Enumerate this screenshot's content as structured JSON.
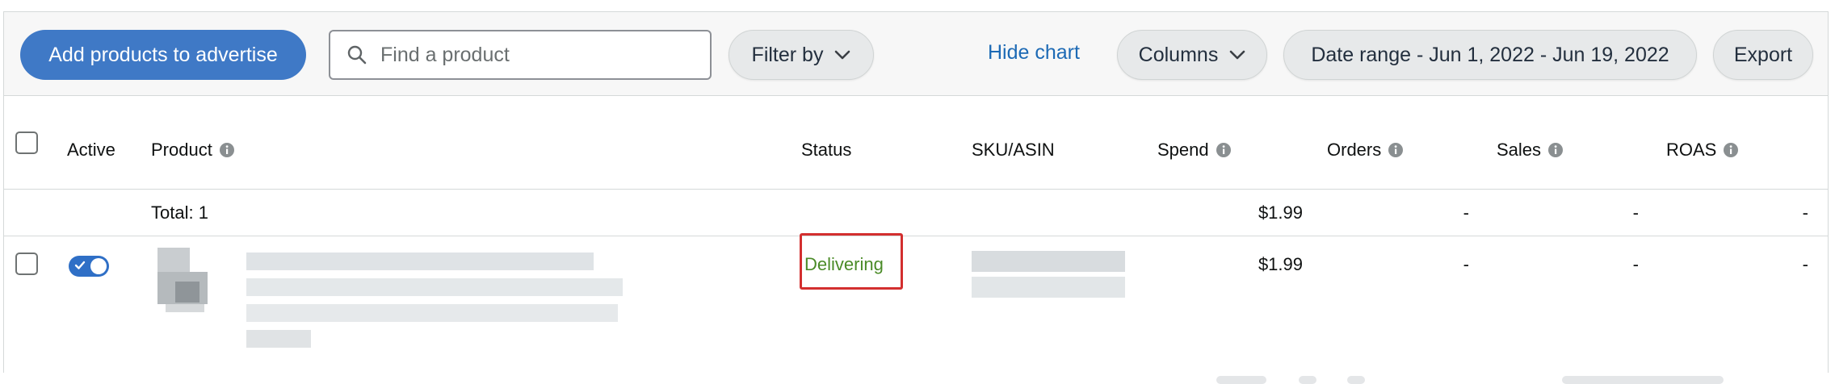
{
  "toolbar": {
    "add_products_label": "Add products to advertise",
    "search_placeholder": "Find a product",
    "filter_label": "Filter by",
    "hide_chart_label": "Hide chart",
    "columns_label": "Columns",
    "date_range_label": "Date range - Jun 1, 2022 - Jun 19, 2022",
    "export_label": "Export"
  },
  "table": {
    "headers": {
      "active": "Active",
      "product": "Product",
      "status": "Status",
      "sku": "SKU/ASIN",
      "spend": "Spend",
      "orders": "Orders",
      "sales": "Sales",
      "roas": "ROAS"
    },
    "total_row": {
      "label": "Total: 1",
      "spend": "$1.99",
      "orders": "-",
      "sales": "-",
      "roas": "-"
    },
    "rows": [
      {
        "active": true,
        "status": "Delivering",
        "spend": "$1.99",
        "orders": "-",
        "sales": "-",
        "roas": "-"
      }
    ]
  },
  "colors": {
    "primary_button": "#3f79c6",
    "link": "#1d6ab5",
    "status_delivering": "#4a8b27",
    "highlight": "#d32f2f"
  }
}
